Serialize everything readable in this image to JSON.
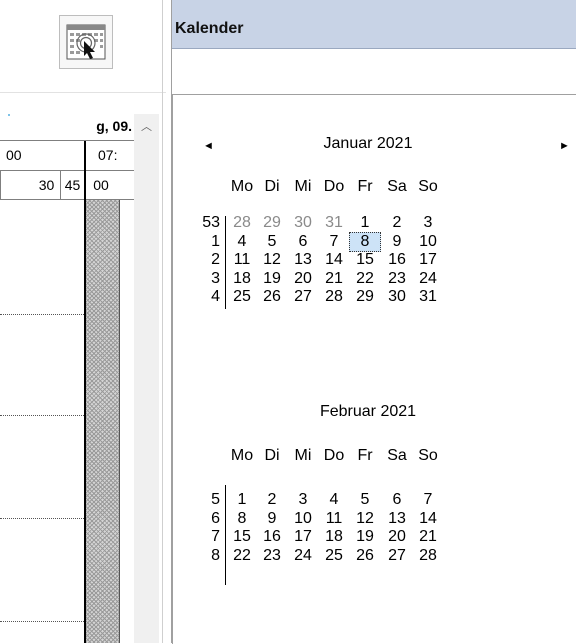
{
  "schedule": {
    "date_header": "g, 09.",
    "hour_labels": [
      "00",
      "07:"
    ],
    "minute_labels": [
      "30",
      "45",
      "00"
    ]
  },
  "calendar": {
    "title": "Kalender",
    "prev_label": "◄",
    "next_label": "►",
    "day_names": [
      "Mo",
      "Di",
      "Mi",
      "Do",
      "Fr",
      "Sa",
      "So"
    ],
    "months": [
      {
        "title": "Januar 2021",
        "weeks": [
          {
            "week": "53",
            "days": [
              "28",
              "29",
              "30",
              "31",
              "1",
              "2",
              "3"
            ],
            "grey": [
              true,
              true,
              true,
              true,
              false,
              false,
              false
            ]
          },
          {
            "week": "1",
            "days": [
              "4",
              "5",
              "6",
              "7",
              "8",
              "9",
              "10"
            ],
            "grey": [
              false,
              false,
              false,
              false,
              false,
              false,
              false
            ]
          },
          {
            "week": "2",
            "days": [
              "11",
              "12",
              "13",
              "14",
              "15",
              "16",
              "17"
            ],
            "grey": [
              false,
              false,
              false,
              false,
              false,
              false,
              false
            ]
          },
          {
            "week": "3",
            "days": [
              "18",
              "19",
              "20",
              "21",
              "22",
              "23",
              "24"
            ],
            "grey": [
              false,
              false,
              false,
              false,
              false,
              false,
              false
            ]
          },
          {
            "week": "4",
            "days": [
              "25",
              "26",
              "27",
              "28",
              "29",
              "30",
              "31"
            ],
            "grey": [
              false,
              false,
              false,
              false,
              false,
              false,
              false
            ]
          }
        ],
        "today": "8"
      },
      {
        "title": "Februar 2021",
        "weeks": [
          {
            "week": "5",
            "days": [
              "1",
              "2",
              "3",
              "4",
              "5",
              "6",
              "7"
            ],
            "grey": [
              false,
              false,
              false,
              false,
              false,
              false,
              false
            ]
          },
          {
            "week": "6",
            "days": [
              "8",
              "9",
              "10",
              "11",
              "12",
              "13",
              "14"
            ],
            "grey": [
              false,
              false,
              false,
              false,
              false,
              false,
              false
            ]
          },
          {
            "week": "7",
            "days": [
              "15",
              "16",
              "17",
              "18",
              "19",
              "20",
              "21"
            ],
            "grey": [
              false,
              false,
              false,
              false,
              false,
              false,
              false
            ]
          },
          {
            "week": "8",
            "days": [
              "22",
              "23",
              "24",
              "25",
              "26",
              "27",
              "28"
            ],
            "grey": [
              false,
              false,
              false,
              false,
              false,
              false,
              false
            ]
          }
        ]
      }
    ]
  },
  "colors": {
    "title_bar": "#c8d3e6",
    "today_highlight": "#cde3f7",
    "other_month_text": "#8a8a8a"
  }
}
